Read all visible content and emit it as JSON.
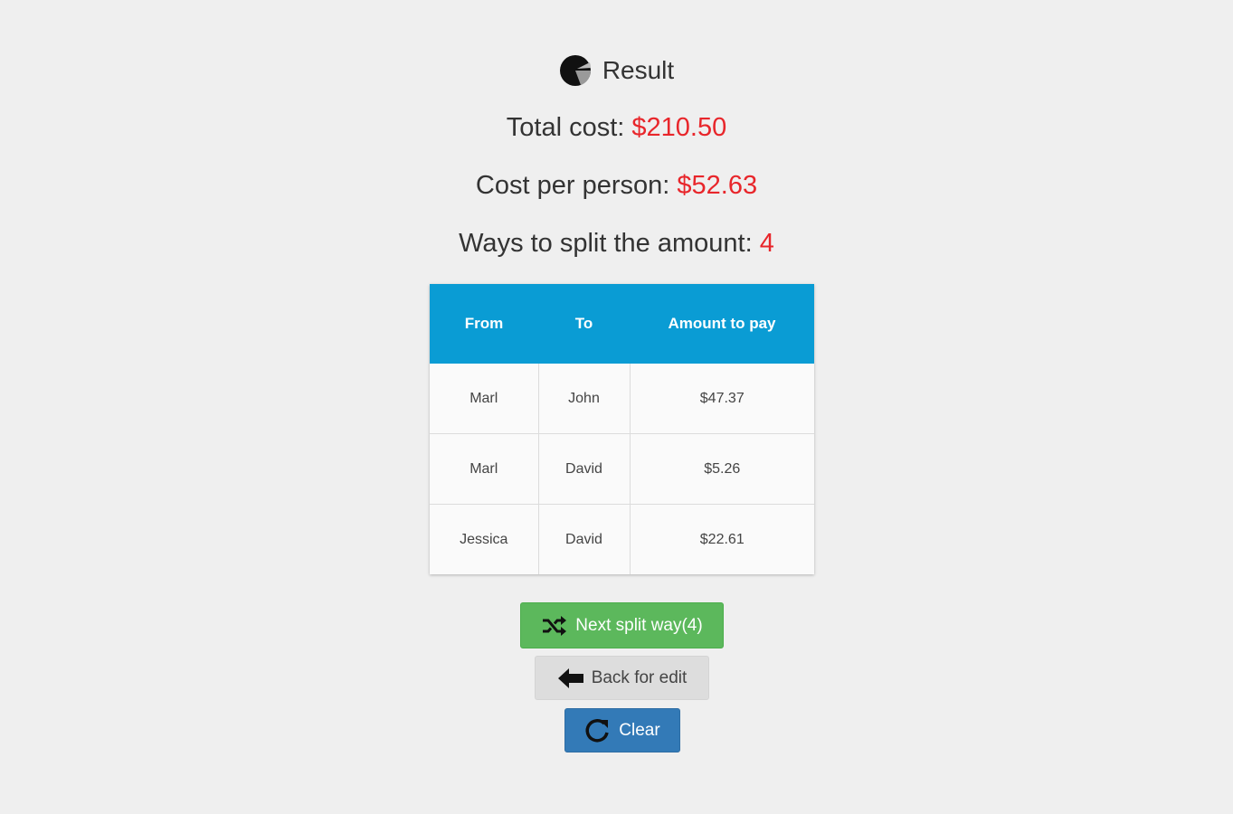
{
  "header": {
    "title": "Result",
    "icon": "pie-chart-icon"
  },
  "stats": {
    "total_label": "Total cost:",
    "total_value": "$210.50",
    "per_person_label": "Cost per person:",
    "per_person_value": "$52.63",
    "ways_label": "Ways to split the amount:",
    "ways_value": "4",
    "value_color": "#e8262b"
  },
  "table": {
    "columns": [
      "From",
      "To",
      "Amount to pay"
    ],
    "rows": [
      [
        "Marl",
        "John",
        "$47.37"
      ],
      [
        "Marl",
        "David",
        "$5.26"
      ],
      [
        "Jessica",
        "David",
        "$22.61"
      ]
    ],
    "header_color": "#0a9cd4"
  },
  "buttons": {
    "next_label": "Next split way(4)",
    "next_icon": "shuffle-icon",
    "back_label": "Back for edit",
    "back_icon": "arrow-left-icon",
    "clear_label": "Clear",
    "clear_icon": "refresh-icon"
  },
  "colors": {
    "next": "#5cb85c",
    "back": "#dddddd",
    "clear": "#337ab7"
  }
}
